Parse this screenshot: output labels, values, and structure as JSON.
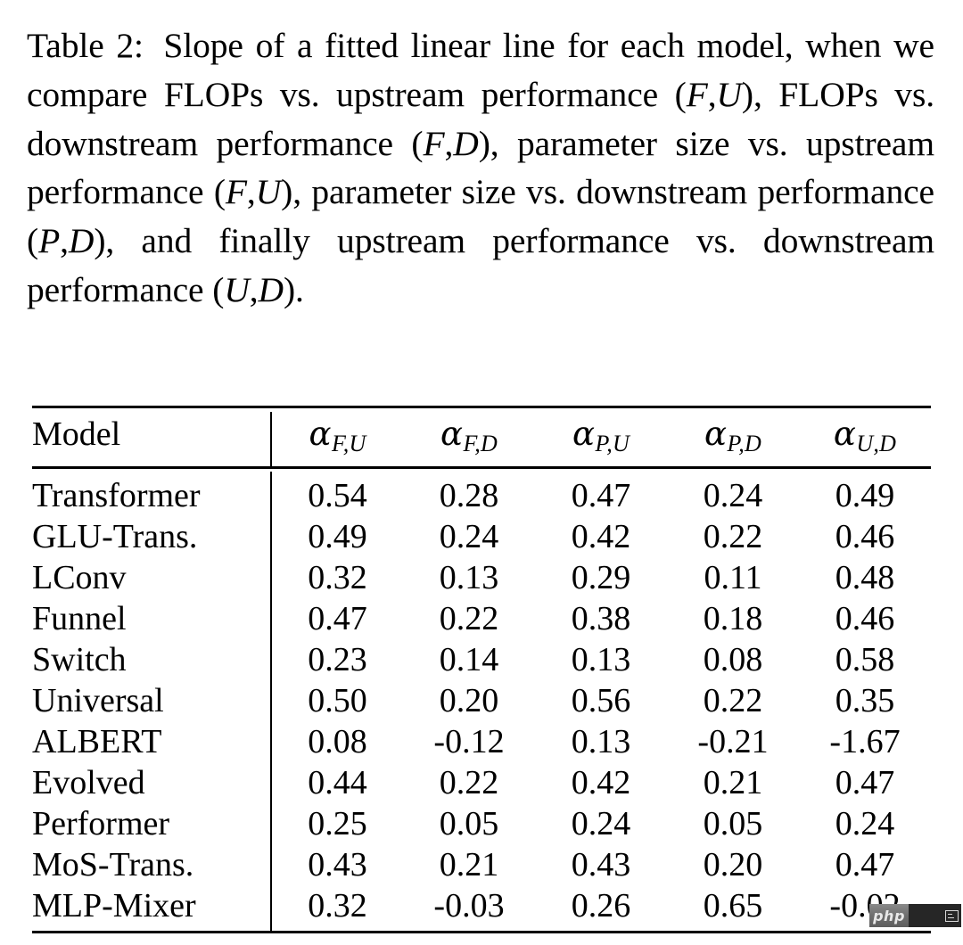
{
  "caption": {
    "label": "Table 2:",
    "segments": [
      {
        "t": "text",
        "v": "Slope of a fitted linear line for each model, when we compare FLOPs vs. upstream performance "
      },
      {
        "t": "math",
        "v": "(F,U)"
      },
      {
        "t": "text",
        "v": ", FLOPs vs. downstream performance "
      },
      {
        "t": "math",
        "v": "(F,D)"
      },
      {
        "t": "text",
        "v": ", parameter size vs. upstream performance "
      },
      {
        "t": "math",
        "v": "(F,U)"
      },
      {
        "t": "text",
        "v": ", parameter size vs. downstream performance "
      },
      {
        "t": "math",
        "v": "(P,D)"
      },
      {
        "t": "text",
        "v": ", and finally upstream performance vs. downstream performance "
      },
      {
        "t": "math",
        "v": "(U,D)"
      },
      {
        "t": "text",
        "v": "."
      }
    ],
    "full_text": "Table 2: Slope of a fitted linear line for each model, when we compare FLOPs vs. upstream performance (F,U), FLOPs vs. downstream performance (F,D), parameter size vs. upstream performance (F,U), parameter size vs. downstream performance (P,D), and finally upstream performance vs. downstream performance (U,D)."
  },
  "chart_data": {
    "type": "table",
    "title": "Table 2",
    "columns": [
      {
        "key": "model",
        "label": "Model",
        "align": "left"
      },
      {
        "key": "a_fu",
        "symbol": "α",
        "subscript": "F,U",
        "align": "center"
      },
      {
        "key": "a_fd",
        "symbol": "α",
        "subscript": "F,D",
        "align": "center"
      },
      {
        "key": "a_pu",
        "symbol": "α",
        "subscript": "P,U",
        "align": "center"
      },
      {
        "key": "a_pd",
        "symbol": "α",
        "subscript": "P,D",
        "align": "center"
      },
      {
        "key": "a_ud",
        "symbol": "α",
        "subscript": "U,D",
        "align": "center"
      }
    ],
    "rows": [
      {
        "model": "Transformer",
        "values": [
          "0.54",
          "0.28",
          "0.47",
          "0.24",
          "0.49"
        ],
        "bold": [
          true,
          true,
          true,
          true,
          false
        ]
      },
      {
        "model": "GLU-Trans.",
        "values": [
          "0.49",
          "0.24",
          "0.42",
          "0.22",
          "0.46"
        ],
        "bold": [
          false,
          false,
          false,
          false,
          false
        ]
      },
      {
        "model": "LConv",
        "values": [
          "0.32",
          "0.13",
          "0.29",
          "0.11",
          "0.48"
        ],
        "bold": [
          false,
          false,
          false,
          false,
          false
        ]
      },
      {
        "model": "Funnel",
        "values": [
          "0.47",
          "0.22",
          "0.38",
          "0.18",
          "0.46"
        ],
        "bold": [
          false,
          false,
          false,
          false,
          false
        ]
      },
      {
        "model": "Switch",
        "values": [
          "0.23",
          "0.14",
          "0.13",
          "0.08",
          "0.58"
        ],
        "bold": [
          false,
          false,
          false,
          false,
          true
        ]
      },
      {
        "model": "Universal",
        "values": [
          "0.50",
          "0.20",
          "0.56",
          "0.22",
          "0.35"
        ],
        "bold": [
          false,
          false,
          false,
          false,
          false
        ]
      },
      {
        "model": "ALBERT",
        "values": [
          "0.08",
          "-0.12",
          "0.13",
          "-0.21",
          "-1.67"
        ],
        "bold": [
          false,
          false,
          false,
          false,
          false
        ]
      },
      {
        "model": "Evolved",
        "values": [
          "0.44",
          "0.22",
          "0.42",
          "0.21",
          "0.47"
        ],
        "bold": [
          false,
          false,
          false,
          false,
          false
        ]
      },
      {
        "model": "Performer",
        "values": [
          "0.25",
          "0.05",
          "0.24",
          "0.05",
          "0.24"
        ],
        "bold": [
          false,
          false,
          false,
          false,
          false
        ]
      },
      {
        "model": "MoS-Trans.",
        "values": [
          "0.43",
          "0.21",
          "0.43",
          "0.20",
          "0.47"
        ],
        "bold": [
          false,
          false,
          false,
          false,
          false
        ]
      },
      {
        "model": "MLP-Mixer",
        "values": [
          "0.32",
          "-0.03",
          "0.26",
          "0.65",
          "-0.02"
        ],
        "bold": [
          false,
          false,
          false,
          false,
          false
        ]
      }
    ]
  },
  "watermark": {
    "php_label": "php",
    "badge_icon": "window-icon"
  },
  "colors": {
    "background": "#ffffff",
    "text": "#000000",
    "rule": "#000000",
    "watermark_php_bg": "#6f6f6f",
    "watermark_dark_bg": "#262626"
  }
}
